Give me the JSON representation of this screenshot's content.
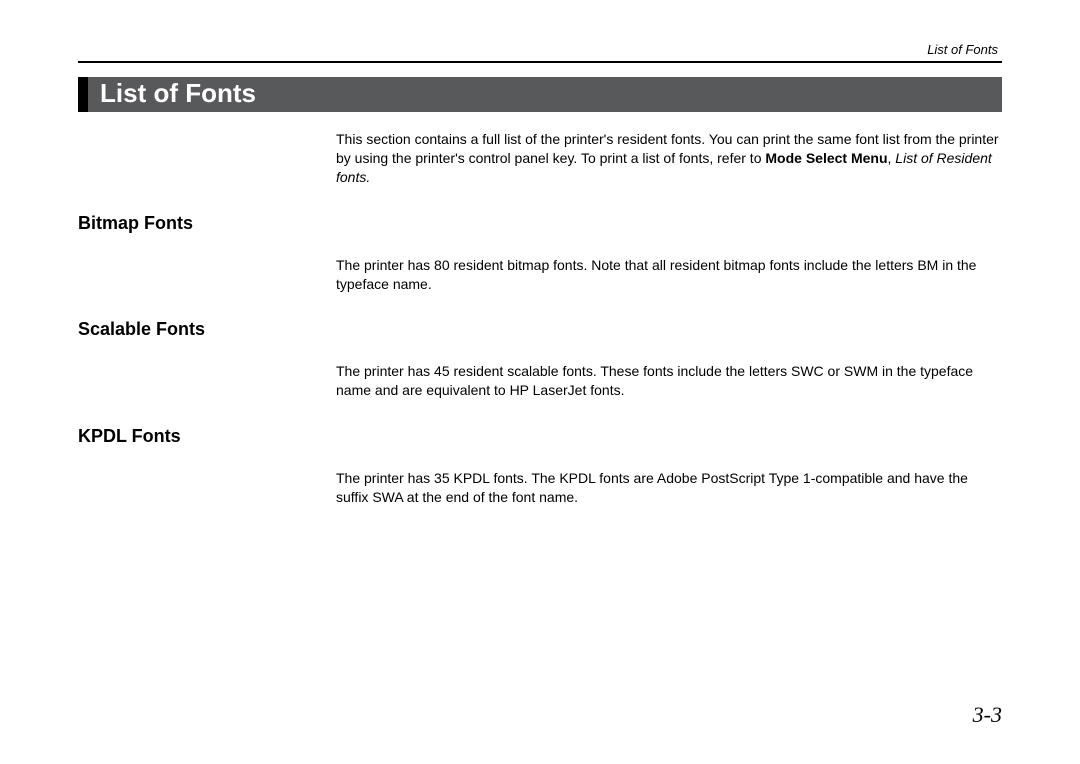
{
  "header": {
    "running_title": "List of Fonts"
  },
  "title": "List of Fonts",
  "intro": {
    "part1": "This section contains a full list of the printer's resident fonts. You can print the same font list from the printer by using the printer's control panel key.  To print a list of fonts, refer to ",
    "bold": "Mode Select Menu",
    "comma": ", ",
    "italic": "List  of Resident fonts.",
    "part2": ""
  },
  "sections": [
    {
      "heading": "Bitmap Fonts",
      "body": "The printer has 80 resident bitmap fonts. Note that all resident bitmap fonts include the letters BM in the typeface name."
    },
    {
      "heading": "Scalable Fonts",
      "body": "The printer has 45 resident scalable fonts. These fonts include the letters SWC or SWM in the typeface name and are equivalent to HP LaserJet fonts."
    },
    {
      "heading": "KPDL Fonts",
      "body": "The printer has 35 KPDL fonts. The KPDL fonts are Adobe PostScript Type 1-compatible and have the suffix SWA at the end of the font name."
    }
  ],
  "page_number": "3-3"
}
